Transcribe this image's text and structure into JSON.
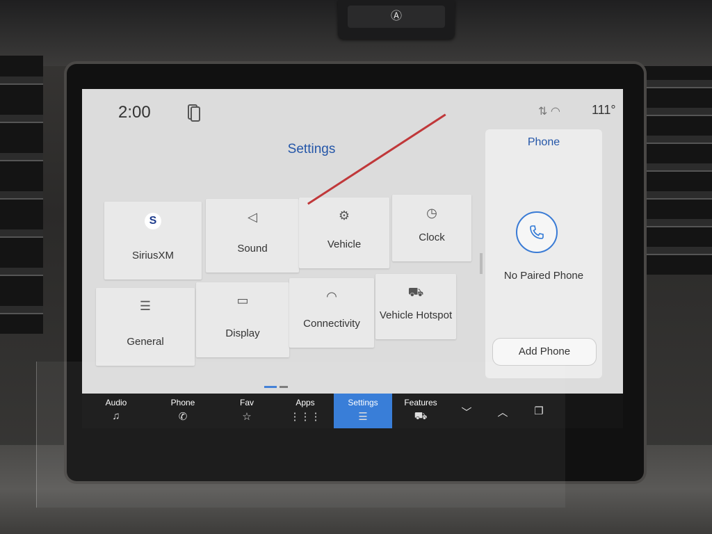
{
  "status": {
    "time": "2:00",
    "temperature": "111°"
  },
  "settings": {
    "title": "Settings",
    "tiles": [
      {
        "label": "SiriusXM",
        "icon": "siriusxm-icon",
        "badge": "S"
      },
      {
        "label": "Sound",
        "icon": "speaker-icon"
      },
      {
        "label": "Vehicle",
        "icon": "vehicle-settings-icon"
      },
      {
        "label": "Clock",
        "icon": "clock-icon"
      },
      {
        "label": "General",
        "icon": "sliders-icon"
      },
      {
        "label": "Display",
        "icon": "display-icon"
      },
      {
        "label": "Connectivity",
        "icon": "wifi-icon"
      },
      {
        "label": "Vehicle Hotspot",
        "icon": "truck-hotspot-icon"
      }
    ]
  },
  "phone_panel": {
    "title": "Phone",
    "status": "No Paired Phone",
    "add_button": "Add Phone"
  },
  "navbar": {
    "items": [
      {
        "label": "Audio",
        "icon": "music-note-icon"
      },
      {
        "label": "Phone",
        "icon": "phone-icon"
      },
      {
        "label": "Fav",
        "icon": "star-icon"
      },
      {
        "label": "Apps",
        "icon": "grid-icon"
      },
      {
        "label": "Settings",
        "icon": "sliders-icon",
        "active": true
      },
      {
        "label": "Features",
        "icon": "truck-icon"
      }
    ]
  },
  "colors": {
    "accent": "#2f78d6",
    "title_blue": "#2456a8",
    "screen_bg": "#dcdcdc"
  }
}
